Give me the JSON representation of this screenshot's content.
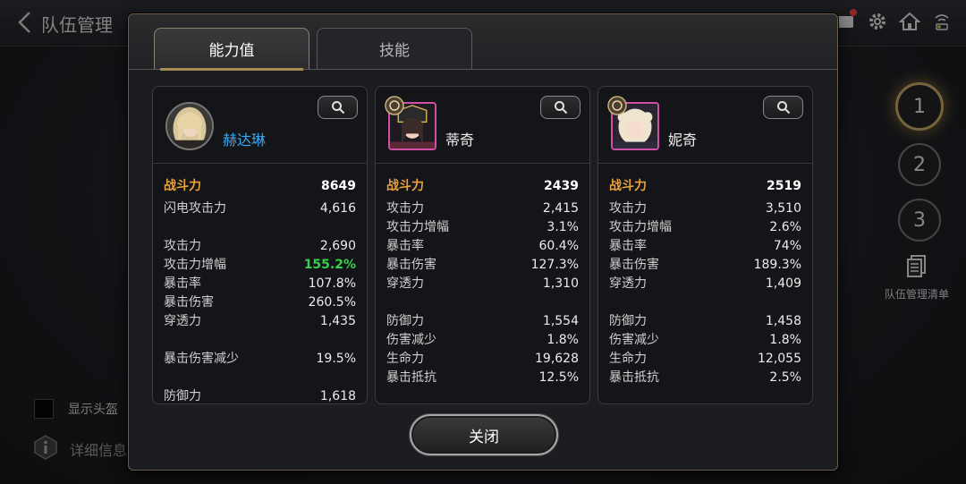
{
  "header": {
    "title": "队伍管理"
  },
  "right_rail": {
    "slots": [
      "1",
      "2",
      "3"
    ],
    "team_list_label": "队伍管理清单"
  },
  "bottom_left": {
    "show_helmet_label": "显示头盔",
    "detail_label": "详细信息"
  },
  "modal": {
    "tabs": [
      "能力值",
      "技能"
    ],
    "close_label": "关闭",
    "cards": [
      {
        "name": "赫达琳",
        "power_label": "战斗力",
        "power_value": "8649",
        "stats": [
          {
            "label": "闪电攻击力",
            "value": "4,616"
          },
          {
            "label": "",
            "value": ""
          },
          {
            "label": "攻击力",
            "value": "2,690"
          },
          {
            "label": "攻击力增幅",
            "value": "155.2%"
          },
          {
            "label": "暴击率",
            "value": "107.8%"
          },
          {
            "label": "暴击伤害",
            "value": "260.5%"
          },
          {
            "label": "穿透力",
            "value": "1,435"
          },
          {
            "label": "",
            "value": ""
          },
          {
            "label": "暴击伤害减少",
            "value": "19.5%"
          },
          {
            "label": "",
            "value": ""
          },
          {
            "label": "防御力",
            "value": "1,618"
          }
        ]
      },
      {
        "name": "蒂奇",
        "power_label": "战斗力",
        "power_value": "2439",
        "stats": [
          {
            "label": "攻击力",
            "value": "2,415"
          },
          {
            "label": "攻击力增幅",
            "value": "3.1%"
          },
          {
            "label": "暴击率",
            "value": "60.4%"
          },
          {
            "label": "暴击伤害",
            "value": "127.3%"
          },
          {
            "label": "穿透力",
            "value": "1,310"
          },
          {
            "label": "",
            "value": ""
          },
          {
            "label": "防御力",
            "value": "1,554"
          },
          {
            "label": "伤害减少",
            "value": "1.8%"
          },
          {
            "label": "生命力",
            "value": "19,628"
          },
          {
            "label": "暴击抵抗",
            "value": "12.5%"
          }
        ]
      },
      {
        "name": "妮奇",
        "power_label": "战斗力",
        "power_value": "2519",
        "stats": [
          {
            "label": "攻击力",
            "value": "3,510"
          },
          {
            "label": "攻击力增幅",
            "value": "2.6%"
          },
          {
            "label": "暴击率",
            "value": "74%"
          },
          {
            "label": "暴击伤害",
            "value": "189.3%"
          },
          {
            "label": "穿透力",
            "value": "1,409"
          },
          {
            "label": "",
            "value": ""
          },
          {
            "label": "防御力",
            "value": "1,458"
          },
          {
            "label": "伤害减少",
            "value": "1.8%"
          },
          {
            "label": "生命力",
            "value": "12,055"
          },
          {
            "label": "暴击抵抗",
            "value": "2.5%"
          }
        ]
      }
    ]
  },
  "colors": {
    "power_label": "#e9a13b",
    "highlight_name": "#3aa8f0",
    "boost_green": "#37d04a",
    "tab_accent": "#a58d55"
  }
}
